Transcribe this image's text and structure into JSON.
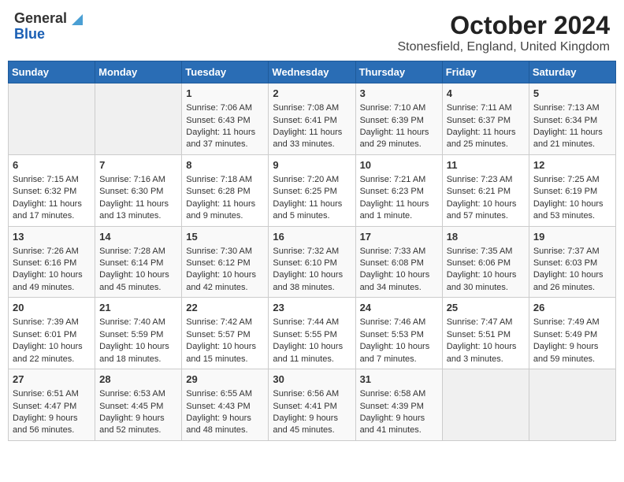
{
  "header": {
    "logo": {
      "general": "General",
      "blue": "Blue"
    },
    "title": "October 2024",
    "subtitle": "Stonesfield, England, United Kingdom"
  },
  "calendar": {
    "days_of_week": [
      "Sunday",
      "Monday",
      "Tuesday",
      "Wednesday",
      "Thursday",
      "Friday",
      "Saturday"
    ],
    "weeks": [
      {
        "days": [
          {
            "number": "",
            "sunrise": "",
            "sunset": "",
            "daylight": "",
            "empty": true
          },
          {
            "number": "",
            "sunrise": "",
            "sunset": "",
            "daylight": "",
            "empty": true
          },
          {
            "number": "1",
            "sunrise": "Sunrise: 7:06 AM",
            "sunset": "Sunset: 6:43 PM",
            "daylight": "Daylight: 11 hours and 37 minutes.",
            "empty": false
          },
          {
            "number": "2",
            "sunrise": "Sunrise: 7:08 AM",
            "sunset": "Sunset: 6:41 PM",
            "daylight": "Daylight: 11 hours and 33 minutes.",
            "empty": false
          },
          {
            "number": "3",
            "sunrise": "Sunrise: 7:10 AM",
            "sunset": "Sunset: 6:39 PM",
            "daylight": "Daylight: 11 hours and 29 minutes.",
            "empty": false
          },
          {
            "number": "4",
            "sunrise": "Sunrise: 7:11 AM",
            "sunset": "Sunset: 6:37 PM",
            "daylight": "Daylight: 11 hours and 25 minutes.",
            "empty": false
          },
          {
            "number": "5",
            "sunrise": "Sunrise: 7:13 AM",
            "sunset": "Sunset: 6:34 PM",
            "daylight": "Daylight: 11 hours and 21 minutes.",
            "empty": false
          }
        ]
      },
      {
        "days": [
          {
            "number": "6",
            "sunrise": "Sunrise: 7:15 AM",
            "sunset": "Sunset: 6:32 PM",
            "daylight": "Daylight: 11 hours and 17 minutes.",
            "empty": false
          },
          {
            "number": "7",
            "sunrise": "Sunrise: 7:16 AM",
            "sunset": "Sunset: 6:30 PM",
            "daylight": "Daylight: 11 hours and 13 minutes.",
            "empty": false
          },
          {
            "number": "8",
            "sunrise": "Sunrise: 7:18 AM",
            "sunset": "Sunset: 6:28 PM",
            "daylight": "Daylight: 11 hours and 9 minutes.",
            "empty": false
          },
          {
            "number": "9",
            "sunrise": "Sunrise: 7:20 AM",
            "sunset": "Sunset: 6:25 PM",
            "daylight": "Daylight: 11 hours and 5 minutes.",
            "empty": false
          },
          {
            "number": "10",
            "sunrise": "Sunrise: 7:21 AM",
            "sunset": "Sunset: 6:23 PM",
            "daylight": "Daylight: 11 hours and 1 minute.",
            "empty": false
          },
          {
            "number": "11",
            "sunrise": "Sunrise: 7:23 AM",
            "sunset": "Sunset: 6:21 PM",
            "daylight": "Daylight: 10 hours and 57 minutes.",
            "empty": false
          },
          {
            "number": "12",
            "sunrise": "Sunrise: 7:25 AM",
            "sunset": "Sunset: 6:19 PM",
            "daylight": "Daylight: 10 hours and 53 minutes.",
            "empty": false
          }
        ]
      },
      {
        "days": [
          {
            "number": "13",
            "sunrise": "Sunrise: 7:26 AM",
            "sunset": "Sunset: 6:16 PM",
            "daylight": "Daylight: 10 hours and 49 minutes.",
            "empty": false
          },
          {
            "number": "14",
            "sunrise": "Sunrise: 7:28 AM",
            "sunset": "Sunset: 6:14 PM",
            "daylight": "Daylight: 10 hours and 45 minutes.",
            "empty": false
          },
          {
            "number": "15",
            "sunrise": "Sunrise: 7:30 AM",
            "sunset": "Sunset: 6:12 PM",
            "daylight": "Daylight: 10 hours and 42 minutes.",
            "empty": false
          },
          {
            "number": "16",
            "sunrise": "Sunrise: 7:32 AM",
            "sunset": "Sunset: 6:10 PM",
            "daylight": "Daylight: 10 hours and 38 minutes.",
            "empty": false
          },
          {
            "number": "17",
            "sunrise": "Sunrise: 7:33 AM",
            "sunset": "Sunset: 6:08 PM",
            "daylight": "Daylight: 10 hours and 34 minutes.",
            "empty": false
          },
          {
            "number": "18",
            "sunrise": "Sunrise: 7:35 AM",
            "sunset": "Sunset: 6:06 PM",
            "daylight": "Daylight: 10 hours and 30 minutes.",
            "empty": false
          },
          {
            "number": "19",
            "sunrise": "Sunrise: 7:37 AM",
            "sunset": "Sunset: 6:03 PM",
            "daylight": "Daylight: 10 hours and 26 minutes.",
            "empty": false
          }
        ]
      },
      {
        "days": [
          {
            "number": "20",
            "sunrise": "Sunrise: 7:39 AM",
            "sunset": "Sunset: 6:01 PM",
            "daylight": "Daylight: 10 hours and 22 minutes.",
            "empty": false
          },
          {
            "number": "21",
            "sunrise": "Sunrise: 7:40 AM",
            "sunset": "Sunset: 5:59 PM",
            "daylight": "Daylight: 10 hours and 18 minutes.",
            "empty": false
          },
          {
            "number": "22",
            "sunrise": "Sunrise: 7:42 AM",
            "sunset": "Sunset: 5:57 PM",
            "daylight": "Daylight: 10 hours and 15 minutes.",
            "empty": false
          },
          {
            "number": "23",
            "sunrise": "Sunrise: 7:44 AM",
            "sunset": "Sunset: 5:55 PM",
            "daylight": "Daylight: 10 hours and 11 minutes.",
            "empty": false
          },
          {
            "number": "24",
            "sunrise": "Sunrise: 7:46 AM",
            "sunset": "Sunset: 5:53 PM",
            "daylight": "Daylight: 10 hours and 7 minutes.",
            "empty": false
          },
          {
            "number": "25",
            "sunrise": "Sunrise: 7:47 AM",
            "sunset": "Sunset: 5:51 PM",
            "daylight": "Daylight: 10 hours and 3 minutes.",
            "empty": false
          },
          {
            "number": "26",
            "sunrise": "Sunrise: 7:49 AM",
            "sunset": "Sunset: 5:49 PM",
            "daylight": "Daylight: 9 hours and 59 minutes.",
            "empty": false
          }
        ]
      },
      {
        "days": [
          {
            "number": "27",
            "sunrise": "Sunrise: 6:51 AM",
            "sunset": "Sunset: 4:47 PM",
            "daylight": "Daylight: 9 hours and 56 minutes.",
            "empty": false
          },
          {
            "number": "28",
            "sunrise": "Sunrise: 6:53 AM",
            "sunset": "Sunset: 4:45 PM",
            "daylight": "Daylight: 9 hours and 52 minutes.",
            "empty": false
          },
          {
            "number": "29",
            "sunrise": "Sunrise: 6:55 AM",
            "sunset": "Sunset: 4:43 PM",
            "daylight": "Daylight: 9 hours and 48 minutes.",
            "empty": false
          },
          {
            "number": "30",
            "sunrise": "Sunrise: 6:56 AM",
            "sunset": "Sunset: 4:41 PM",
            "daylight": "Daylight: 9 hours and 45 minutes.",
            "empty": false
          },
          {
            "number": "31",
            "sunrise": "Sunrise: 6:58 AM",
            "sunset": "Sunset: 4:39 PM",
            "daylight": "Daylight: 9 hours and 41 minutes.",
            "empty": false
          },
          {
            "number": "",
            "sunrise": "",
            "sunset": "",
            "daylight": "",
            "empty": true
          },
          {
            "number": "",
            "sunrise": "",
            "sunset": "",
            "daylight": "",
            "empty": true
          }
        ]
      }
    ]
  }
}
